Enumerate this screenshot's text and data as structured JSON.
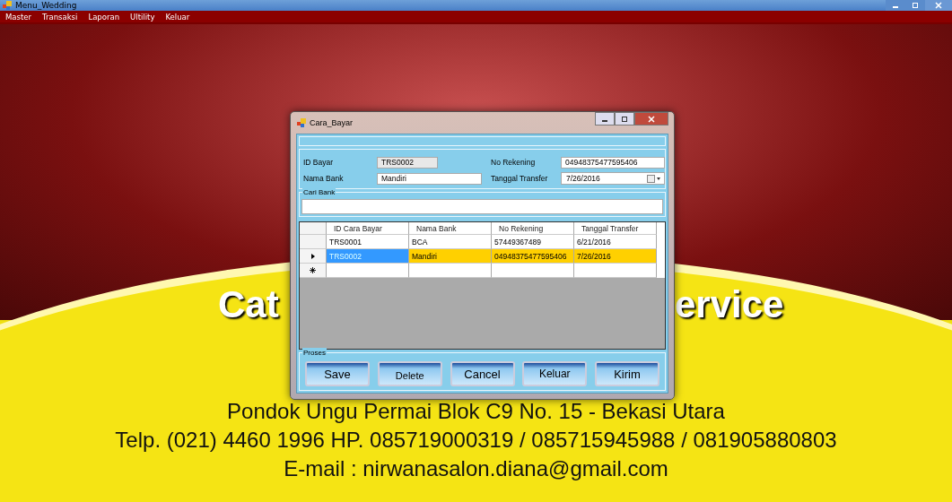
{
  "window": {
    "title": "Menu_Wedding"
  },
  "menu": [
    "Master",
    "Transaksi",
    "Laporan",
    "Ultility",
    "Keluar"
  ],
  "banner": {
    "fragments": [
      "Cat",
      "ervice"
    ],
    "lines": [
      "Pondok Ungu Permai Blok C9 No. 15 - Bekasi Utara",
      "Telp. (021) 4460 1996 HP. 085719000319 / 085715945988 / 081905880803",
      "E-mail : nirwanasalon.diana@gmail.com"
    ]
  },
  "dialog": {
    "title": "Cara_Bayar",
    "fields": {
      "id_bayar": {
        "label": "ID Bayar",
        "value": "TRS0002"
      },
      "nama_bank": {
        "label": "Nama Bank",
        "value": "Mandiri"
      },
      "no_rekening": {
        "label": "No Rekening",
        "value": "04948375477595406"
      },
      "tanggal_transfer": {
        "label": "Tanggal Transfer",
        "value": "7/26/2016"
      }
    },
    "search_group": {
      "label": "Cari Bank"
    },
    "table": {
      "columns": [
        "ID Cara Bayar",
        "Nama Bank",
        "No Rekening",
        "Tanggal Transfer"
      ],
      "rows": [
        {
          "cells": [
            "TRS0001",
            "BCA",
            "57449367489",
            "6/21/2016"
          ],
          "selected": false
        },
        {
          "cells": [
            "TRS0002",
            "Mandiri",
            "04948375477595406",
            "7/26/2016"
          ],
          "selected": true
        }
      ]
    },
    "actions_group": {
      "label": "Proses"
    },
    "buttons": [
      "Save",
      "Delete",
      "Cancel",
      "Keluar",
      "Kirim"
    ]
  }
}
